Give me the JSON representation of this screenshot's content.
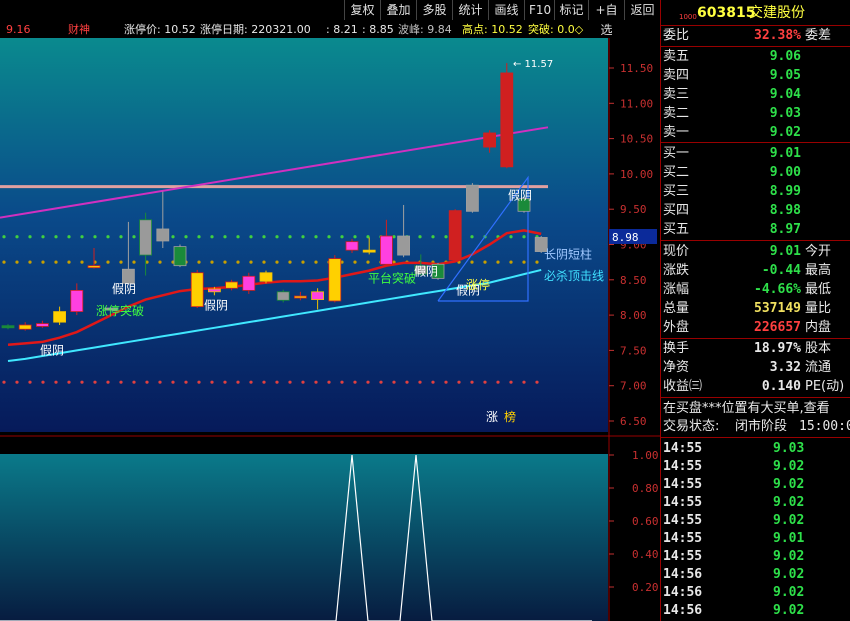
{
  "toolbar": {
    "buttons": [
      "复权",
      "叠加",
      "多股",
      "统计",
      "画线",
      "F10",
      "标记",
      "+自选",
      "返回"
    ]
  },
  "infobar": {
    "left_value": "9.16",
    "formula_name": "财神",
    "limit_price": "涨停价: 10.52",
    "limit_date": "涨停日期: 220321.00",
    "v1": ": 8.21",
    "v2": ": 8.85",
    "wave_peak": "波峰: 9.84",
    "high_point": "高点: 10.52",
    "breakout": "突破: 0.0◇"
  },
  "chart_data": {
    "type": "candlestick",
    "price_axis": [
      "11.50",
      "11.00",
      "10.50",
      "10.00",
      "9.50",
      "9.00",
      "8.50",
      "8.00",
      "7.50",
      "7.00",
      "6.50"
    ],
    "indicator_axis": [
      "1.00",
      "0.80",
      "0.60",
      "0.40",
      "0.20"
    ],
    "current_price_tag": "8.98",
    "high_label": "11.57",
    "annotations": [
      "假阴",
      "假阴",
      "涨停突破",
      "假阴",
      "平台突破",
      "假阴",
      "假阴",
      "涨停",
      "假阴",
      "长阴短柱",
      "必杀顶击线",
      "涨",
      "榜"
    ],
    "candles": [
      {
        "o": 7.82,
        "c": 7.85,
        "h": 7.87,
        "l": 7.8,
        "up": false
      },
      {
        "o": 7.8,
        "c": 7.86,
        "h": 7.9,
        "l": 7.78,
        "up": true
      },
      {
        "o": 7.84,
        "c": 7.88,
        "h": 7.92,
        "l": 7.82,
        "up": true
      },
      {
        "o": 7.9,
        "c": 8.05,
        "h": 8.12,
        "l": 7.86,
        "up": true
      },
      {
        "o": 8.05,
        "c": 8.35,
        "h": 8.45,
        "l": 8.0,
        "up": true
      },
      {
        "o": 8.68,
        "c": 8.7,
        "h": 8.95,
        "l": 8.66,
        "up": true
      },
      {
        "o": 8.1,
        "c": 8.1,
        "h": 8.1,
        "l": 8.1,
        "up": false
      },
      {
        "o": 8.45,
        "c": 8.65,
        "h": 9.32,
        "l": 8.43,
        "up": false
      },
      {
        "o": 8.85,
        "c": 9.35,
        "h": 9.45,
        "l": 8.56,
        "up": false
      },
      {
        "o": 9.22,
        "c": 9.05,
        "h": 9.75,
        "l": 8.95,
        "up": false
      },
      {
        "o": 8.7,
        "c": 8.97,
        "h": 9.0,
        "l": 8.68,
        "up": false
      },
      {
        "o": 8.12,
        "c": 8.6,
        "h": 8.64,
        "l": 8.1,
        "up": true
      },
      {
        "o": 8.33,
        "c": 8.37,
        "h": 8.4,
        "l": 8.28,
        "up": true
      },
      {
        "o": 8.38,
        "c": 8.47,
        "h": 8.5,
        "l": 8.35,
        "up": true
      },
      {
        "o": 8.35,
        "c": 8.55,
        "h": 8.6,
        "l": 8.3,
        "up": true
      },
      {
        "o": 8.48,
        "c": 8.6,
        "h": 8.63,
        "l": 8.45,
        "up": true
      },
      {
        "o": 8.33,
        "c": 8.21,
        "h": 8.36,
        "l": 8.18,
        "up": false
      },
      {
        "o": 8.26,
        "c": 8.27,
        "h": 8.33,
        "l": 8.21,
        "up": true
      },
      {
        "o": 8.22,
        "c": 8.33,
        "h": 8.38,
        "l": 8.08,
        "up": true
      },
      {
        "o": 8.2,
        "c": 8.8,
        "h": 8.85,
        "l": 8.18,
        "up": true
      },
      {
        "o": 8.92,
        "c": 9.04,
        "h": 9.08,
        "l": 8.88,
        "up": true
      },
      {
        "o": 8.9,
        "c": 8.92,
        "h": 9.1,
        "l": 8.86,
        "up": true
      },
      {
        "o": 8.72,
        "c": 9.12,
        "h": 9.35,
        "l": 8.7,
        "up": true
      },
      {
        "o": 9.12,
        "c": 8.85,
        "h": 9.56,
        "l": 8.82,
        "up": false
      },
      {
        "o": 8.58,
        "c": 8.7,
        "h": 8.86,
        "l": 8.56,
        "up": false
      },
      {
        "o": 8.72,
        "c": 8.52,
        "h": 8.74,
        "l": 8.5,
        "up": false
      },
      {
        "o": 8.78,
        "c": 9.48,
        "h": 9.5,
        "l": 8.76,
        "up": true
      },
      {
        "o": 9.84,
        "c": 9.47,
        "h": 9.87,
        "l": 9.45,
        "up": false
      },
      {
        "o": 10.38,
        "c": 10.58,
        "h": 10.62,
        "l": 10.3,
        "up": true
      },
      {
        "o": 10.1,
        "c": 11.43,
        "h": 11.57,
        "l": 10.08,
        "up": true
      },
      {
        "o": 9.47,
        "c": 9.65,
        "h": 9.68,
        "l": 9.45,
        "up": false
      },
      {
        "o": 8.9,
        "c": 9.1,
        "h": 9.12,
        "l": 8.88,
        "up": false
      }
    ],
    "indicator_series": [
      0,
      0,
      0,
      0,
      0,
      0,
      0,
      0,
      0,
      0,
      0,
      0,
      0,
      0,
      0,
      0,
      0,
      0,
      0,
      0,
      0,
      0,
      1,
      0,
      0,
      0,
      1,
      0,
      0,
      0,
      0,
      0,
      0,
      0,
      0,
      0,
      0,
      0
    ]
  },
  "quote": {
    "code": "603815",
    "name": "交建股份",
    "weibi_label": "委比",
    "weibi_value": "32.38%",
    "weicha_label": "委差",
    "asks": [
      {
        "label": "卖五",
        "price": "9.06"
      },
      {
        "label": "卖四",
        "price": "9.05"
      },
      {
        "label": "卖三",
        "price": "9.04"
      },
      {
        "label": "卖二",
        "price": "9.03"
      },
      {
        "label": "卖一",
        "price": "9.02"
      }
    ],
    "bids": [
      {
        "label": "买一",
        "price": "9.01"
      },
      {
        "label": "买二",
        "price": "9.00"
      },
      {
        "label": "买三",
        "price": "8.99"
      },
      {
        "label": "买四",
        "price": "8.98"
      },
      {
        "label": "买五",
        "price": "8.97"
      }
    ],
    "stats": [
      {
        "label": "现价",
        "value": "9.01",
        "label2": "今开",
        "color": "#2ee04a"
      },
      {
        "label": "涨跌",
        "value": "-0.44",
        "label2": "最高",
        "color": "#2ee04a"
      },
      {
        "label": "涨幅",
        "value": "-4.66%",
        "label2": "最低",
        "color": "#2ee04a"
      },
      {
        "label": "总量",
        "value": "537149",
        "label2": "量比",
        "color": "#f0e060"
      },
      {
        "label": "外盘",
        "value": "226657",
        "label2": "内盘",
        "color": "#ff4040"
      }
    ],
    "stats2": [
      {
        "label": "换手",
        "value": "18.97%",
        "label2": "股本",
        "color": "#e8e8e8"
      },
      {
        "label": "净资",
        "value": "3.32",
        "label2": "流通",
        "color": "#e8e8e8"
      },
      {
        "label": "收益㈢",
        "value": "0.140",
        "label2": "PE(动)",
        "color": "#e8e8e8"
      }
    ],
    "notice": "在买盘***位置有大买单,查看",
    "status_label": "交易状态:",
    "status_value": "闭市阶段",
    "status_time": "15:00:0",
    "ticks": [
      {
        "time": "14:55",
        "price": "9.03"
      },
      {
        "time": "14:55",
        "price": "9.02"
      },
      {
        "time": "14:55",
        "price": "9.02"
      },
      {
        "time": "14:55",
        "price": "9.02"
      },
      {
        "time": "14:55",
        "price": "9.02"
      },
      {
        "time": "14:55",
        "price": "9.01"
      },
      {
        "time": "14:55",
        "price": "9.02"
      },
      {
        "time": "14:56",
        "price": "9.02"
      },
      {
        "time": "14:56",
        "price": "9.02"
      },
      {
        "time": "14:56",
        "price": "9.02"
      }
    ]
  }
}
